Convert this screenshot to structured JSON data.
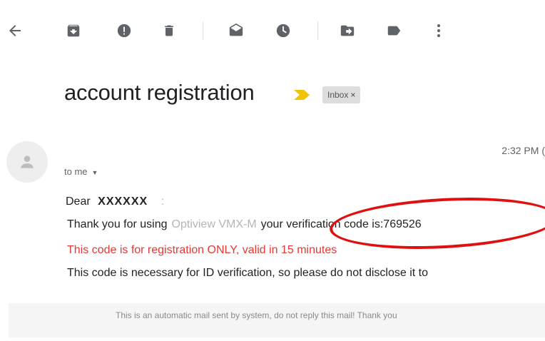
{
  "toolbar": {
    "icons": [
      "back-arrow-icon",
      "archive-icon",
      "report-spam-icon",
      "delete-icon",
      "mark-unread-icon",
      "snooze-icon",
      "move-to-icon",
      "label-icon",
      "more-icon"
    ]
  },
  "email": {
    "subject": "account registration",
    "label_chip": "Inbox",
    "label_chip_close": "×",
    "time": "2:32 PM (",
    "recipient": "to me",
    "greeting": "Dear",
    "name": "XXXXXX",
    "greeting_colon": ":",
    "thanks_prefix": "Thank you for using",
    "app_name": "Optiview VMX-M",
    "code_text": "your verification code is:769526",
    "red_notice": "This code is for registration ONLY, valid in 15 minutes",
    "necessary_notice": "This code is necessary for ID verification, so please do not disclose it to",
    "footer": "This is an automatic mail sent by system, do not reply this mail! Thank you"
  },
  "colors": {
    "red_text": "#e53935",
    "annotation_ellipse": "#e01010",
    "importance_marker": "#f2c300"
  }
}
